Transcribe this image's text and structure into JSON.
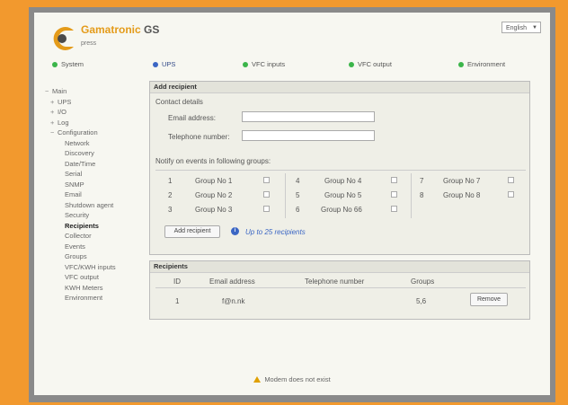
{
  "header": {
    "brand": "Gamatronic",
    "brand_suffix": "GS",
    "subbrand": "press",
    "language": "English"
  },
  "tabs": [
    {
      "label": "System",
      "color": "#3bb54a",
      "active": false
    },
    {
      "label": "UPS",
      "color": "#3b66c4",
      "active": true
    },
    {
      "label": "VFC inputs",
      "color": "#3bb54a",
      "active": false
    },
    {
      "label": "VFC output",
      "color": "#3bb54a",
      "active": false
    },
    {
      "label": "Environment",
      "color": "#3bb54a",
      "active": false
    }
  ],
  "sidebar": {
    "items": [
      {
        "label": "Main",
        "toggle": "−",
        "level": 0
      },
      {
        "label": "UPS",
        "toggle": "+",
        "level": 1
      },
      {
        "label": "I/O",
        "toggle": "+",
        "level": 1
      },
      {
        "label": "Log",
        "toggle": "+",
        "level": 1
      },
      {
        "label": "Configuration",
        "toggle": "−",
        "level": 1
      },
      {
        "label": "Network",
        "level": 2
      },
      {
        "label": "Discovery",
        "level": 2
      },
      {
        "label": "Date/Time",
        "level": 2
      },
      {
        "label": "Serial",
        "level": 2
      },
      {
        "label": "SNMP",
        "level": 2
      },
      {
        "label": "Email",
        "level": 2
      },
      {
        "label": "Shutdown agent",
        "level": 2
      },
      {
        "label": "Security",
        "level": 2
      },
      {
        "label": "Recipients",
        "level": 2,
        "active": true
      },
      {
        "label": "Collector",
        "level": 2
      },
      {
        "label": "Events",
        "level": 2
      },
      {
        "label": "Groups",
        "level": 2
      },
      {
        "label": "VFC/KWH inputs",
        "level": 2
      },
      {
        "label": "VFC output",
        "level": 2
      },
      {
        "label": "KWH Meters",
        "level": 2
      },
      {
        "label": "Environment",
        "level": 2
      }
    ]
  },
  "add_recipient": {
    "title": "Add recipient",
    "contact_details_label": "Contact details",
    "email_label": "Email address:",
    "email_value": "",
    "phone_label": "Telephone number:",
    "phone_value": "",
    "notify_label": "Notify on events in following groups:",
    "groups": [
      {
        "num": "1",
        "name": "Group No 1"
      },
      {
        "num": "2",
        "name": "Group No 2"
      },
      {
        "num": "3",
        "name": "Group No 3"
      },
      {
        "num": "4",
        "name": "Group No 4"
      },
      {
        "num": "5",
        "name": "Group No 5"
      },
      {
        "num": "6",
        "name": "Group No 66"
      },
      {
        "num": "7",
        "name": "Group No 7"
      },
      {
        "num": "8",
        "name": "Group No 8"
      }
    ],
    "add_button": "Add recipient",
    "limit_note": "Up to 25 recipients"
  },
  "recipients": {
    "title": "Recipients",
    "columns": [
      "ID",
      "Email address",
      "Telephone number",
      "Groups"
    ],
    "rows": [
      {
        "id": "1",
        "email": "f@n.nk",
        "phone": "",
        "groups": "5,6"
      }
    ],
    "remove_button": "Remove"
  },
  "status": {
    "message": "Modem does not exist"
  }
}
